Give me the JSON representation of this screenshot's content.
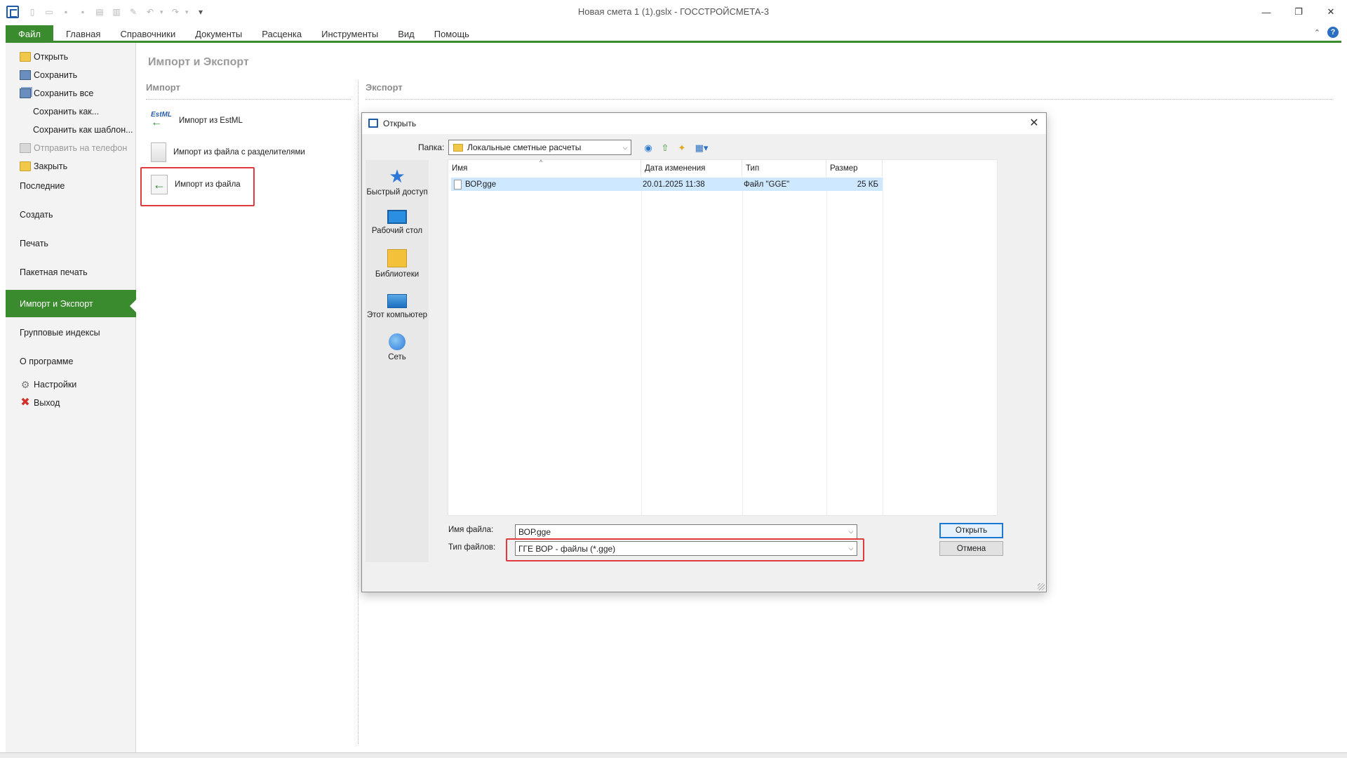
{
  "window": {
    "title": "Новая смета 1 (1).gslx - ГОССТРОЙСМЕТА-3",
    "controls": {
      "minimize": "—",
      "restore": "❐",
      "close": "✕"
    }
  },
  "qat": {
    "icons": [
      "new-icon",
      "open-icon",
      "save-icon",
      "save-all-icon",
      "print-icon",
      "export-icon",
      "edit-icon",
      "undo-icon",
      "redo-icon",
      "customize-icon"
    ],
    "glyphs": {
      "new": "▯",
      "open": "▭",
      "save": "▪",
      "saveall": "▪",
      "print": "▤",
      "export": "▥",
      "edit": "✎",
      "undo": "↶",
      "redo": "↷",
      "customize": "▾",
      "dropdown": "▾"
    }
  },
  "ribbon": {
    "tabs": [
      "Файл",
      "Главная",
      "Справочники",
      "Документы",
      "Расценка",
      "Инструменты",
      "Вид",
      "Помощь"
    ],
    "collapse_glyph": "⌃",
    "help_glyph": "?",
    "accent": "#3a8a2e"
  },
  "backstage": {
    "items": [
      {
        "label": "Открыть",
        "icon": "folder-open-icon"
      },
      {
        "label": "Сохранить",
        "icon": "save-icon"
      },
      {
        "label": "Сохранить все",
        "icon": "save-all-icon"
      },
      {
        "label": "Сохранить как..."
      },
      {
        "label": "Сохранить как шаблон..."
      },
      {
        "label": "Отправить на телефон",
        "icon": "phone-icon",
        "disabled": true
      },
      {
        "label": "Закрыть",
        "icon": "folder-close-icon"
      },
      {
        "label": "Последние"
      },
      {
        "label": "Создать"
      },
      {
        "label": "Печать"
      },
      {
        "label": "Пакетная печать"
      },
      {
        "label": "Импорт и Экспорт",
        "active": true
      },
      {
        "label": "Групповые индексы"
      },
      {
        "label": "О программе"
      },
      {
        "label": "Настройки",
        "icon": "gear-icon"
      },
      {
        "label": "Выход",
        "icon": "exit-icon"
      }
    ],
    "gear_glyph": "⚙",
    "exit_glyph": "✖"
  },
  "main": {
    "heading": "Импорт и Экспорт",
    "import_title": "Импорт",
    "export_title": "Экспорт",
    "import_items": [
      {
        "label": "Импорт из EstML",
        "icon": "estml-icon",
        "icon_text": "EstML"
      },
      {
        "label": "Импорт из файла с разделителями",
        "icon": "delimited-file-icon"
      },
      {
        "label": "Импорт из файла",
        "icon": "file-import-icon"
      }
    ]
  },
  "dialog": {
    "title": "Открыть",
    "close_glyph": "✕",
    "lookin_label": "Папка:",
    "lookin_value": "Локальные сметные расчеты",
    "nav_glyphs": {
      "back": "◉",
      "up": "⇧",
      "newfolder": "✦",
      "views": "▦▾"
    },
    "places": [
      "Быстрый доступ",
      "Рабочий стол",
      "Библиотеки",
      "Этот компьютер",
      "Сеть"
    ],
    "star_glyph": "★",
    "columns": [
      "Имя",
      "Дата изменения",
      "Тип",
      "Размер"
    ],
    "sort_glyph": "^",
    "files": [
      {
        "name": "ВОР.gge",
        "modified": "20.01.2025 11:38",
        "type": "Файл \"GGE\"",
        "size": "25 КБ"
      }
    ],
    "filename_label": "Имя файла:",
    "filename_value": "ВОР.gge",
    "filetype_label": "Тип файлов:",
    "filetype_value": "ГГЕ ВОР - файлы (*.gge)",
    "open_button": "Открыть",
    "cancel_button": "Отмена",
    "dropdown_glyph": "⌵"
  },
  "highlight_color": "#e0393e"
}
